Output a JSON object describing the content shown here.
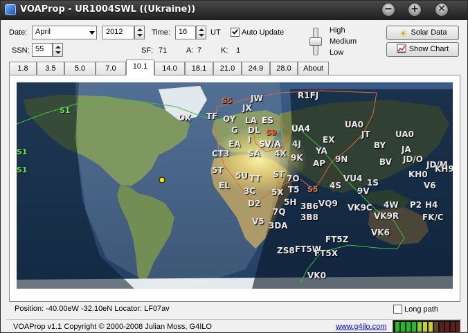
{
  "window": {
    "title": "VOAProp - UR1004SWL ((Ukraine))",
    "controls": [
      "minimize",
      "maximize",
      "close"
    ]
  },
  "settings": {
    "date_label": "Date:",
    "month_value": "April",
    "year_value": "2012",
    "time_label": "Time:",
    "time_value": "16",
    "time_unit": "UT",
    "auto_update_label": "Auto Update",
    "auto_update_checked": true,
    "ssn_label": "SSN:",
    "ssn_value": "55",
    "sf_label": "SF:",
    "sf_value": "71",
    "a_label": "A:",
    "a_value": "7",
    "k_label": "K:",
    "k_value": "1",
    "power_levels": [
      "High",
      "Medium",
      "Low"
    ],
    "power_selected": "Medium",
    "solar_data_label": "Solar Data",
    "show_chart_label": "Show Chart"
  },
  "tabs": [
    "1.8",
    "3.5",
    "5.0",
    "7.0",
    "10.1",
    "14.0",
    "18.1",
    "21.0",
    "24.9",
    "28.0",
    "About"
  ],
  "active_tab": "10.1",
  "map": {
    "sunlit_color": "#ffe97a",
    "contour_color": "#e0663a",
    "contour_labels": [
      "S5",
      "S9",
      "S5"
    ],
    "contour_labels_green": [
      "S1",
      "S1",
      "S1"
    ],
    "prefixes": [
      "R1FJ",
      "JW",
      "JX",
      "OX",
      "TF",
      "OY",
      "LA",
      "ES",
      "G",
      "DL",
      "UA4",
      "S9",
      "EA",
      "I",
      "SV/A",
      "4J",
      "CT3",
      "SA",
      "4X",
      "EX",
      "UA0",
      "JT",
      "UA0",
      "BY",
      "JA",
      "YA",
      "9K",
      "9N",
      "BV",
      "JD/O",
      "JD/M",
      "KH9",
      "AP",
      "ST",
      "5T",
      "EL",
      "5U",
      "TT",
      "7O",
      "VU4",
      "4S",
      "1S",
      "KH0",
      "V6",
      "5X",
      "T5",
      "9V",
      "3C",
      "5H",
      "D2",
      "3B6",
      "VQ9",
      "VK9C",
      "4W",
      "P2",
      "H4",
      "7Q",
      "3B8",
      "VK9R",
      "FK/C",
      "V5",
      "3DA",
      "VK6",
      "FT5Z",
      "ZS8",
      "FT5W",
      "FT5X",
      "VK0"
    ]
  },
  "status": {
    "position_text": "Position: -40.00eW -32.10eN  Locator: LF07av",
    "long_path_label": "Long path",
    "long_path_checked": false
  },
  "footer": {
    "version_text": "VOAProp v1.1  Copyright © 2000-2008  Julian Moss, G4ILO",
    "link_text": "www.g4ilo.com"
  },
  "signal_meter": {
    "level": 0.58,
    "colors": [
      "#1fbf1f",
      "#1fbf1f",
      "#1fbf1f",
      "#1fbf1f",
      "#8fcf1f",
      "#cfcf1f",
      "#cfcf1f",
      "#cf8f1f",
      "#bf2f1f",
      "#bf2f1f",
      "#bf2f1f",
      "#bf2f1f"
    ]
  }
}
